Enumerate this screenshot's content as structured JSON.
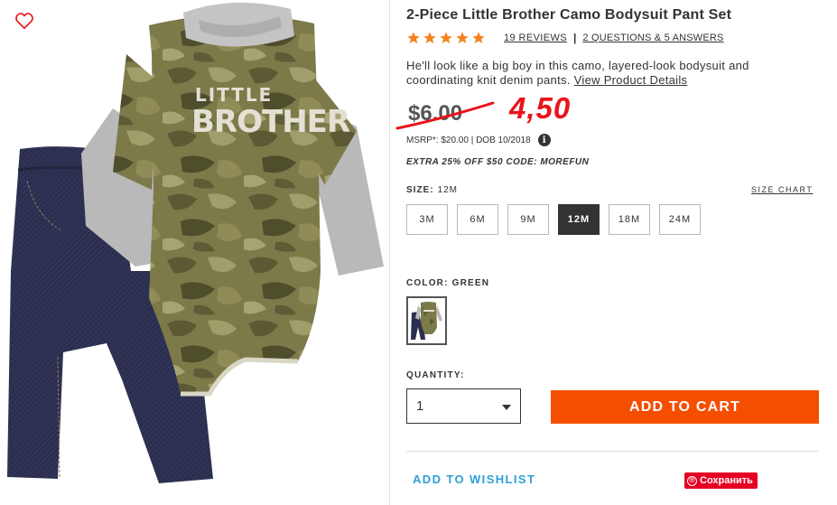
{
  "product": {
    "title": "2-Piece Little Brother Camo Bodysuit Pant Set",
    "rating": 5,
    "reviews_label": "19 REVIEWS",
    "qa_label": "2 QUESTIONS & 5 ANSWERS",
    "description": "He'll look like a big boy in this camo, layered-look bodysuit and coordinating knit denim pants.",
    "details_link": "View Product Details",
    "bodysuit_text_line1": "LITTLE",
    "bodysuit_text_line2": "BROTHER"
  },
  "pricing": {
    "old_price": "$6.00",
    "new_price_annotation": "4,50",
    "msrp_line": "MSRP*: $20.00 | DOB 10/2018",
    "promo": "EXTRA 25% OFF $50 CODE: MOREFUN"
  },
  "size": {
    "label": "SIZE:",
    "selected": "12M",
    "chart_link": "SIZE CHART",
    "options": [
      "3M",
      "6M",
      "9M",
      "12M",
      "18M",
      "24M"
    ]
  },
  "color": {
    "label": "COLOR:",
    "selected": "GREEN"
  },
  "quantity": {
    "label": "QUANTITY:",
    "value": "1"
  },
  "actions": {
    "add_to_cart": "ADD TO CART",
    "wishlist": "ADD TO WISHLIST",
    "pinterest_save": "Сохранить"
  },
  "colors": {
    "accent_orange": "#f54e00",
    "price_red": "#e8141a",
    "link_blue": "#2fa0d6",
    "pinterest_red": "#e60023",
    "star_orange": "#f5821f"
  }
}
